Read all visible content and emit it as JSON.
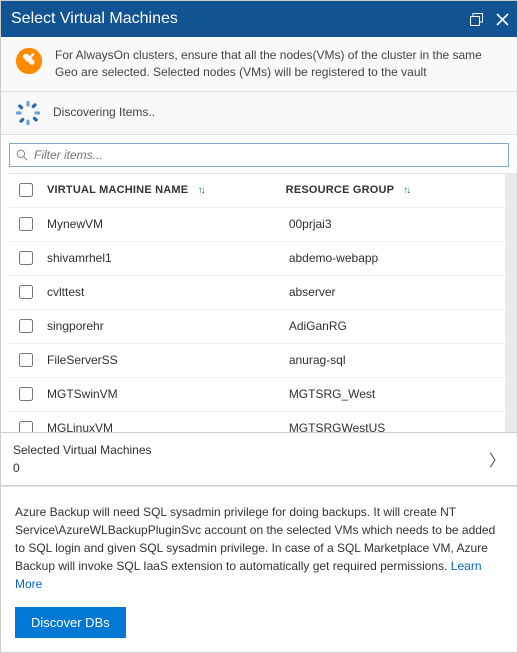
{
  "titlebar": {
    "title": "Select Virtual Machines"
  },
  "info_banner": {
    "text": "For AlwaysOn clusters, ensure that all the nodes(VMs) of the cluster in the same Geo are selected. Selected nodes (VMs) will be registered to the vault"
  },
  "discover_banner": {
    "text": "Discovering Items.."
  },
  "filter": {
    "placeholder": "Filter items..."
  },
  "table": {
    "headers": {
      "name": "VIRTUAL MACHINE NAME",
      "resource_group": "RESOURCE GROUP"
    },
    "rows": [
      {
        "name": "MynewVM",
        "resource_group": "00prjai3"
      },
      {
        "name": "shivamrhel1",
        "resource_group": "abdemo-webapp"
      },
      {
        "name": "cvlttest",
        "resource_group": "abserver"
      },
      {
        "name": "singporehr",
        "resource_group": "AdiGanRG"
      },
      {
        "name": "FileServerSS",
        "resource_group": "anurag-sql"
      },
      {
        "name": "MGTSwinVM",
        "resource_group": "MGTSRG_West"
      },
      {
        "name": "MGLinuxVM",
        "resource_group": "MGTSRGWestUS"
      }
    ]
  },
  "selected": {
    "label": "Selected Virtual Machines",
    "count": "0"
  },
  "footer": {
    "note": "Azure Backup will need SQL sysadmin privilege for doing backups. It will create NT Service\\AzureWLBackupPluginSvc account on the selected VMs which needs to be added to SQL login and given SQL sysadmin privilege. In case of a SQL Marketplace VM, Azure Backup will invoke SQL IaaS extension to automatically get required permissions.",
    "learn_more": "Learn More",
    "discover_button": "Discover DBs"
  }
}
